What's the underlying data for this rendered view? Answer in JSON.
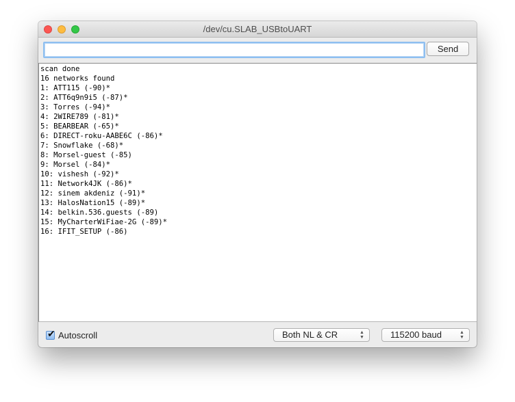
{
  "window": {
    "title": "/dev/cu.SLAB_USBtoUART",
    "traffic_lights": {
      "close": "#fc5753",
      "minimize": "#fdbc40",
      "maximize": "#33c748"
    }
  },
  "input_row": {
    "input_value": "",
    "send_label": "Send"
  },
  "output": {
    "lines": [
      "scan done",
      "16 networks found",
      "1: ATT115 (-90)*",
      "2: ATT6q9n9i5 (-87)*",
      "3: Torres (-94)*",
      "4: 2WIRE789 (-81)*",
      "5: BEARBEAR (-65)*",
      "6: DIRECT-roku-AABE6C (-86)*",
      "7: Snowflake (-68)*",
      "8: Morsel-guest (-85)",
      "9: Morsel (-84)*",
      "10: vishesh (-92)*",
      "11: Network4JK (-86)*",
      "12: sinem akdeniz (-91)*",
      "13: HalosNation15 (-89)*",
      "14: belkin.536.guests (-89)",
      "15: MyCharterWiFiae-2G (-89)*",
      "16: IFIT_SETUP (-86)"
    ]
  },
  "bottom_bar": {
    "autoscroll_label": "Autoscroll",
    "autoscroll_checked": true,
    "line_ending_selected": "Both NL & CR",
    "baud_selected": "115200 baud"
  },
  "icons": {
    "checkmark": "✔",
    "updown_arrows": "▲▼"
  }
}
